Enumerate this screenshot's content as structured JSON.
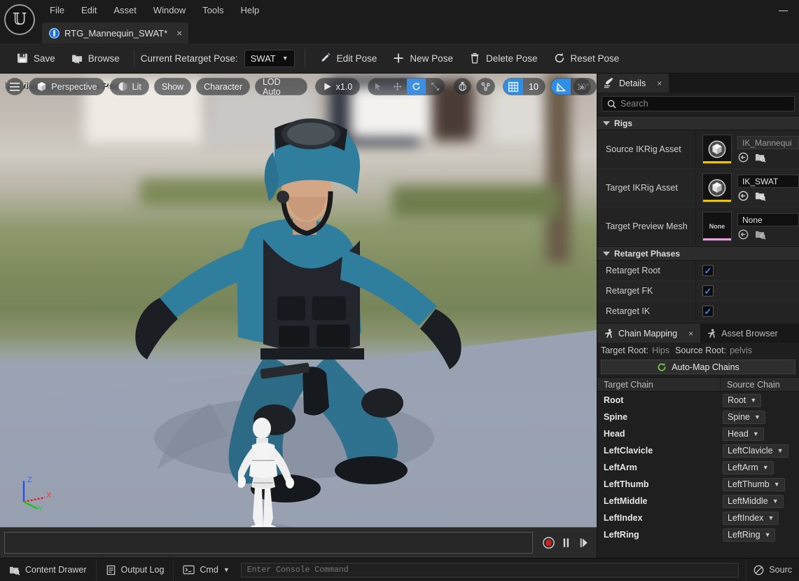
{
  "window": {
    "logo_icon": "unreal-engine-logo",
    "minimize_label": "—"
  },
  "menu": {
    "items": [
      "File",
      "Edit",
      "Asset",
      "Window",
      "Tools",
      "Help"
    ]
  },
  "document_tab": {
    "title": "RTG_Mannequin_SWAT*",
    "icon": "ik-retargeter-icon",
    "close_label": "×"
  },
  "toolbar": {
    "save_label": "Save",
    "browse_label": "Browse",
    "current_pose_label": "Current Retarget Pose:",
    "current_pose_value": "SWAT",
    "edit_pose_label": "Edit Pose",
    "new_pose_label": "New Pose",
    "delete_pose_label": "Delete Pose",
    "reset_pose_label": "Reset Pose"
  },
  "viewport": {
    "overlay_text": "Previewing Reference Pose",
    "menu_icon": "hamburger-icon",
    "perspective_label": "Perspective",
    "lit_label": "Lit",
    "show_label": "Show",
    "character_label": "Character",
    "lod_label": "LOD Auto",
    "playrate_label": "x1.0",
    "grid_snap_value": "10",
    "angle_snap_value": "10°",
    "expand_label": "»",
    "gizmo_axes": [
      "Z",
      "X",
      "Y"
    ],
    "transform_modes": [
      "select-icon",
      "translate-icon",
      "rotate-icon",
      "scale-icon"
    ],
    "active_transform_mode": "rotate-icon"
  },
  "timeline": {
    "record_label": "record",
    "pause_label": "pause",
    "step_label": "step-forward"
  },
  "details": {
    "tab_label": "Details",
    "tab_icon": "details-pencil-icon",
    "close_label": "×",
    "search_placeholder": "Search",
    "categories": [
      {
        "name": "Rigs",
        "rows": [
          {
            "label": "Source IKRig Asset",
            "thumb_text": "",
            "thumb_accent": "#f2c200",
            "value": "IK_Mannequi",
            "value_dim": true
          },
          {
            "label": "Target IKRig Asset",
            "thumb_text": "",
            "thumb_accent": "#f2c200",
            "value": "IK_SWAT",
            "value_dim": false
          },
          {
            "label": "Target Preview Mesh",
            "thumb_text": "None",
            "thumb_accent": "#e99fe0",
            "value": "None",
            "value_dim": false
          }
        ]
      },
      {
        "name": "Retarget Phases",
        "checkbox_rows": [
          {
            "label": "Retarget Root",
            "checked": true
          },
          {
            "label": "Retarget FK",
            "checked": true
          },
          {
            "label": "Retarget IK",
            "checked": true
          }
        ]
      }
    ]
  },
  "chain_mapping": {
    "tab_label": "Chain Mapping",
    "tab_icon": "runner-icon",
    "close_label": "×",
    "other_tab_label": "Asset Browser",
    "other_tab_icon": "runner-icon",
    "target_root_label": "Target Root:",
    "target_root_value": "Hips",
    "source_root_label": "Source Root:",
    "source_root_value": "pelvis",
    "auto_map_label": "Auto-Map Chains",
    "auto_map_icon": "refresh-icon",
    "columns": [
      "Target Chain",
      "Source Chain"
    ],
    "rows": [
      {
        "target": "Root",
        "source": "Root"
      },
      {
        "target": "Spine",
        "source": "Spine"
      },
      {
        "target": "Head",
        "source": "Head"
      },
      {
        "target": "LeftClavicle",
        "source": "LeftClavicle"
      },
      {
        "target": "LeftArm",
        "source": "LeftArm"
      },
      {
        "target": "LeftThumb",
        "source": "LeftThumb"
      },
      {
        "target": "LeftMiddle",
        "source": "LeftMiddle"
      },
      {
        "target": "LeftIndex",
        "source": "LeftIndex"
      },
      {
        "target": "LeftRing",
        "source": "LeftRing"
      }
    ]
  },
  "statusbar": {
    "content_drawer_label": "Content Drawer",
    "content_drawer_icon": "drawer-icon",
    "output_log_label": "Output Log",
    "output_log_icon": "log-icon",
    "cmd_label": "Cmd",
    "cmd_icon": "console-icon",
    "console_placeholder": "Enter Console Command",
    "source_control_label": "Sourc",
    "source_control_icon": "no-entry-icon"
  },
  "colors": {
    "accent_blue": "#3d8fe0",
    "thumb_yellow": "#f2c200",
    "thumb_pink": "#e99fe0",
    "checkbox_blue": "#3b8ae8",
    "record_red": "#cc2222",
    "automap_green": "#7ac943"
  }
}
